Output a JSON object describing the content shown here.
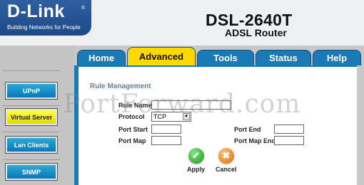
{
  "brand": {
    "logo": "D-Link",
    "registered": "®",
    "tagline": "Building Networks for People",
    "model": "DSL-2640T",
    "product": "ADSL Router"
  },
  "tabs": [
    {
      "label": "Home",
      "active": false
    },
    {
      "label": "Advanced",
      "active": true
    },
    {
      "label": "Tools",
      "active": false
    },
    {
      "label": "Status",
      "active": false
    },
    {
      "label": "Help",
      "active": false
    }
  ],
  "sidebar": [
    {
      "label": "UPnP",
      "active": false
    },
    {
      "label": "Virtual Server",
      "active": true
    },
    {
      "label": "Lan Clients",
      "active": false
    },
    {
      "label": "SNMP",
      "active": false
    }
  ],
  "form": {
    "section_title": "Rule Management",
    "rule_name_label": "Rule Name",
    "rule_name_value": "",
    "protocol_label": "Protocol",
    "protocol_value": "TCP",
    "port_start_label": "Port Start",
    "port_start_value": "",
    "port_end_label": "Port End",
    "port_end_value": "",
    "port_map_label": "Port Map",
    "port_map_value": "",
    "port_map_end_label": "Port Map End",
    "port_map_end_value": ""
  },
  "actions": {
    "apply": "Apply",
    "cancel": "Cancel"
  },
  "watermark": "PortForward.com",
  "colors": {
    "brand_blue": "#1e4986",
    "tab_blue": "#1a7ab5",
    "active_yellow": "#ffd800",
    "sidebar_blue": "#0a78b6"
  }
}
